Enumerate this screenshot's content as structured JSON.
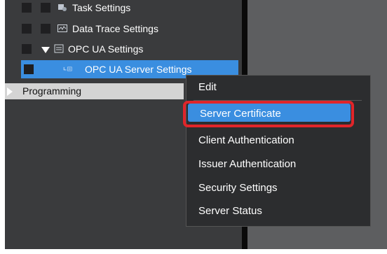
{
  "tree": {
    "items": [
      {
        "label": "Task Settings",
        "icon": "task-settings-icon"
      },
      {
        "label": "Data Trace Settings",
        "icon": "data-trace-icon"
      },
      {
        "label": "OPC UA Settings",
        "icon": "opc-ua-icon",
        "expanded": true
      },
      {
        "label": "OPC UA Server Settings",
        "icon": "opc-ua-server-icon",
        "selected": true
      }
    ],
    "programming": "Programming"
  },
  "context_menu": {
    "items": [
      {
        "label": "Edit"
      },
      {
        "label": "Server Certificate",
        "highlighted": true
      },
      {
        "label": "Client Authentication"
      },
      {
        "label": "Issuer Authentication"
      },
      {
        "label": "Security Settings"
      },
      {
        "label": "Server Status"
      }
    ]
  },
  "colors": {
    "selection": "#3a8ee0",
    "highlight_border": "#e0252a",
    "panel_bg": "#3a3b3d",
    "menu_bg": "#2c2d2f"
  }
}
